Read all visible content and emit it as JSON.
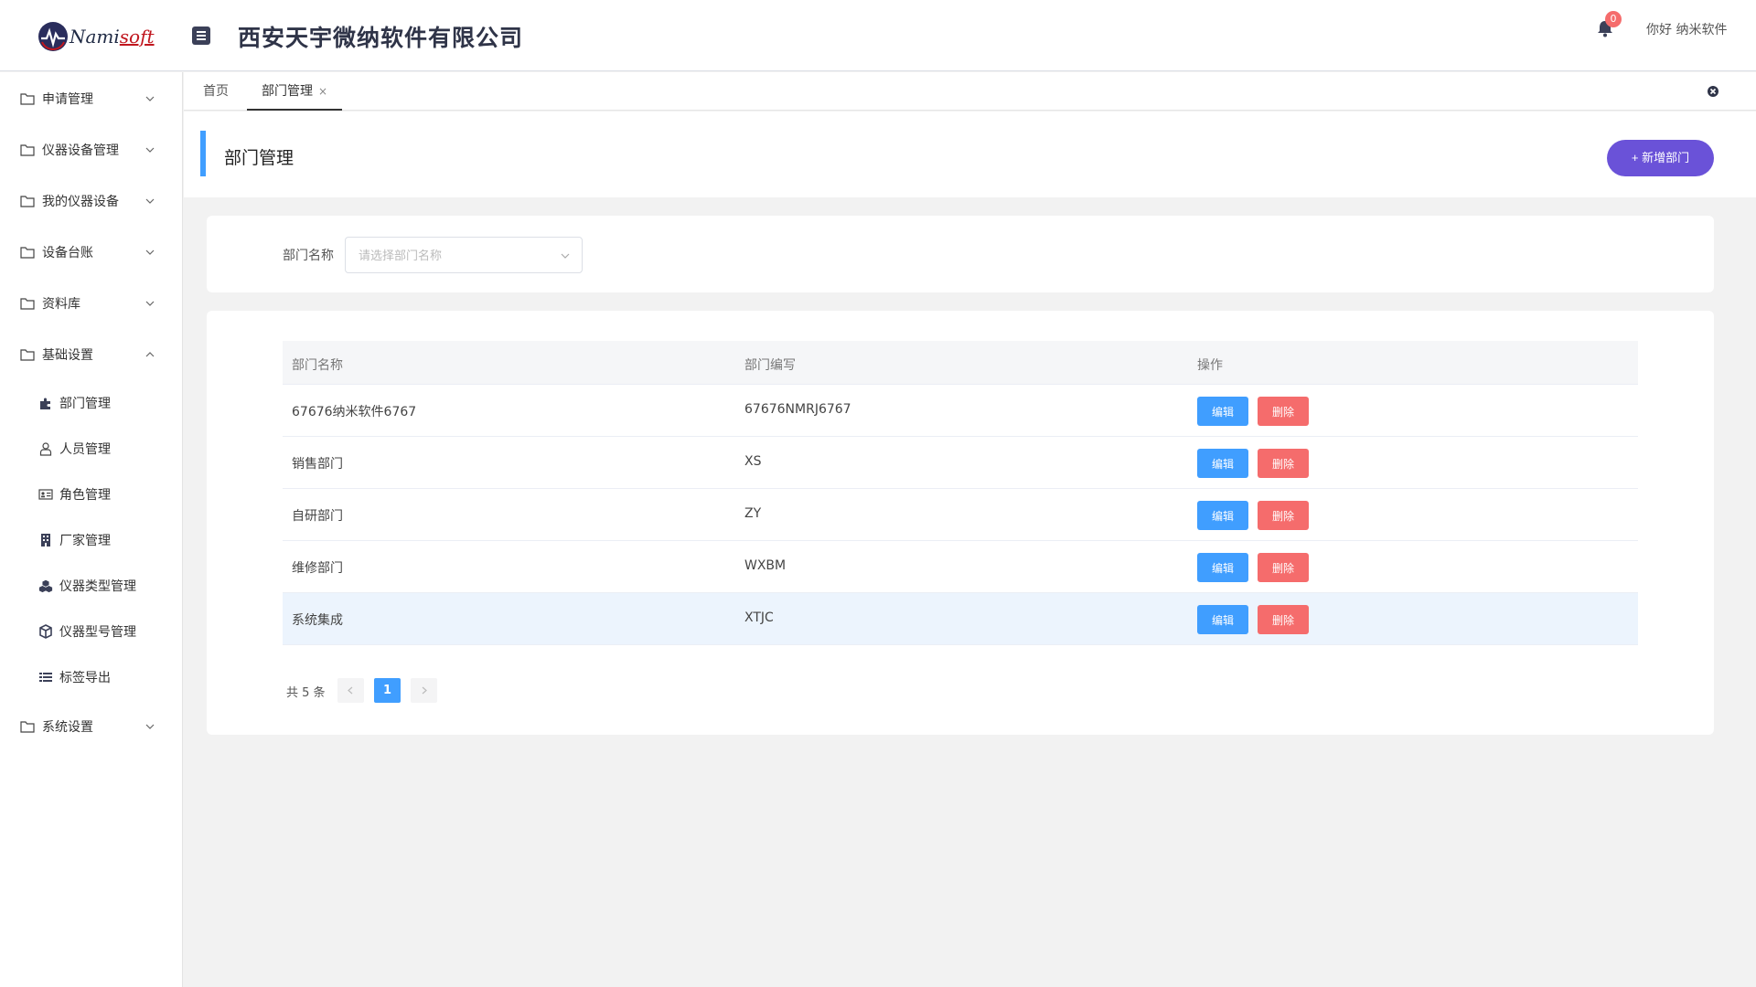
{
  "header": {
    "logo_main": "Nami",
    "logo_accent": "soft",
    "company_name": "西安天宇微纳软件有限公司",
    "notification_count": "0",
    "greeting": "你好 纳米软件"
  },
  "sidebar": {
    "items": [
      {
        "label": "申请管理"
      },
      {
        "label": "仪器设备管理"
      },
      {
        "label": "我的仪器设备"
      },
      {
        "label": "设备台账"
      },
      {
        "label": "资料库"
      },
      {
        "label": "基础设置"
      },
      {
        "label": "系统设置"
      }
    ],
    "sub_items": [
      {
        "label": "部门管理",
        "icon": "puzzle-icon"
      },
      {
        "label": "人员管理",
        "icon": "user-icon"
      },
      {
        "label": "角色管理",
        "icon": "id-card-icon"
      },
      {
        "label": "厂家管理",
        "icon": "building-icon"
      },
      {
        "label": "仪器类型管理",
        "icon": "cubes-icon"
      },
      {
        "label": "仪器型号管理",
        "icon": "cube-icon"
      },
      {
        "label": "标签导出",
        "icon": "list-icon"
      }
    ]
  },
  "tabs": [
    {
      "label": "首页"
    },
    {
      "label": "部门管理",
      "close": "×"
    }
  ],
  "page": {
    "title": "部门管理",
    "add_button": "+ 新增部门"
  },
  "filter": {
    "label": "部门名称",
    "placeholder": "请选择部门名称",
    "value": ""
  },
  "table": {
    "columns": [
      "部门名称",
      "部门编写",
      "操作"
    ],
    "rows": [
      {
        "name": "67676纳米软件6767",
        "code": "67676NMRJ6767"
      },
      {
        "name": "销售部门",
        "code": "XS"
      },
      {
        "name": "自研部门",
        "code": "ZY"
      },
      {
        "name": "维修部门",
        "code": "WXBM"
      },
      {
        "name": "系统集成",
        "code": "XTJC"
      }
    ],
    "edit_label": "编辑",
    "delete_label": "删除"
  },
  "pagination": {
    "total": "共 5 条",
    "current_page": "1"
  },
  "colors": {
    "primary": "#409eff",
    "danger": "#f56c6c",
    "accent_purple": "#6a52d8"
  }
}
